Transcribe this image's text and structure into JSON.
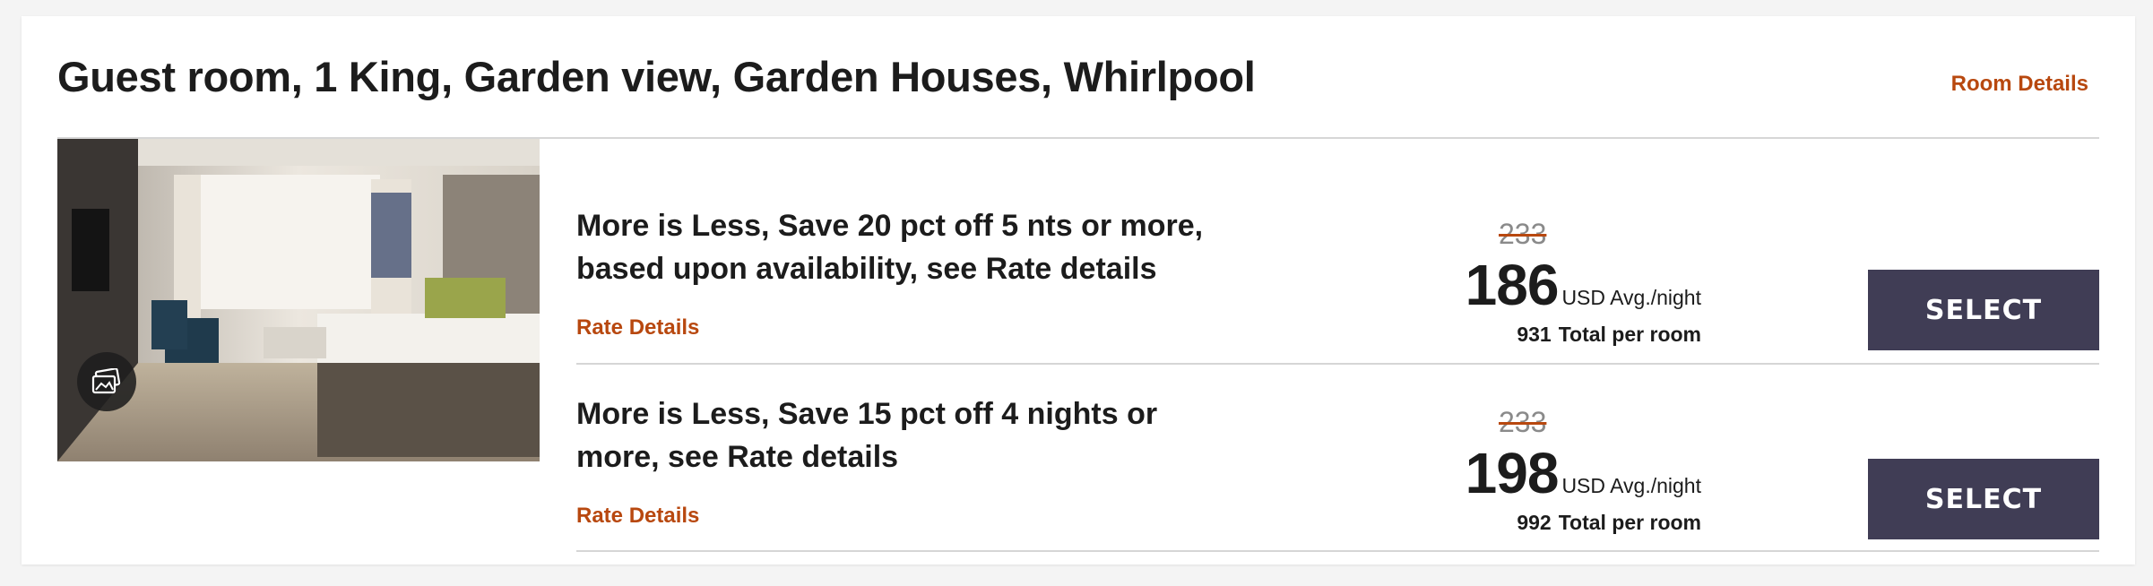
{
  "room": {
    "title": "Guest room, 1 King, Garden view, Garden Houses, Whirlpool",
    "details_link": "Room Details",
    "photo_icon": "gallery-icon"
  },
  "rates": [
    {
      "name": "More is Less, Save 20 pct off 5 nts or more, based upon availability, see Rate details",
      "details_link": "Rate Details",
      "original_price": "233",
      "price": "186",
      "price_unit": "USD Avg./night",
      "total": "931",
      "total_label": "Total per room",
      "select_label": "SELECT"
    },
    {
      "name": "More is Less, Save 15 pct off 4 nights or more, see Rate details",
      "details_link": "Rate Details",
      "original_price": "233",
      "price": "198",
      "price_unit": "USD Avg./night",
      "total": "992",
      "total_label": "Total per room",
      "select_label": "SELECT"
    }
  ],
  "colors": {
    "accent_link": "#b8480f",
    "select_button": "#403d55",
    "background": "#f4f4f4"
  }
}
